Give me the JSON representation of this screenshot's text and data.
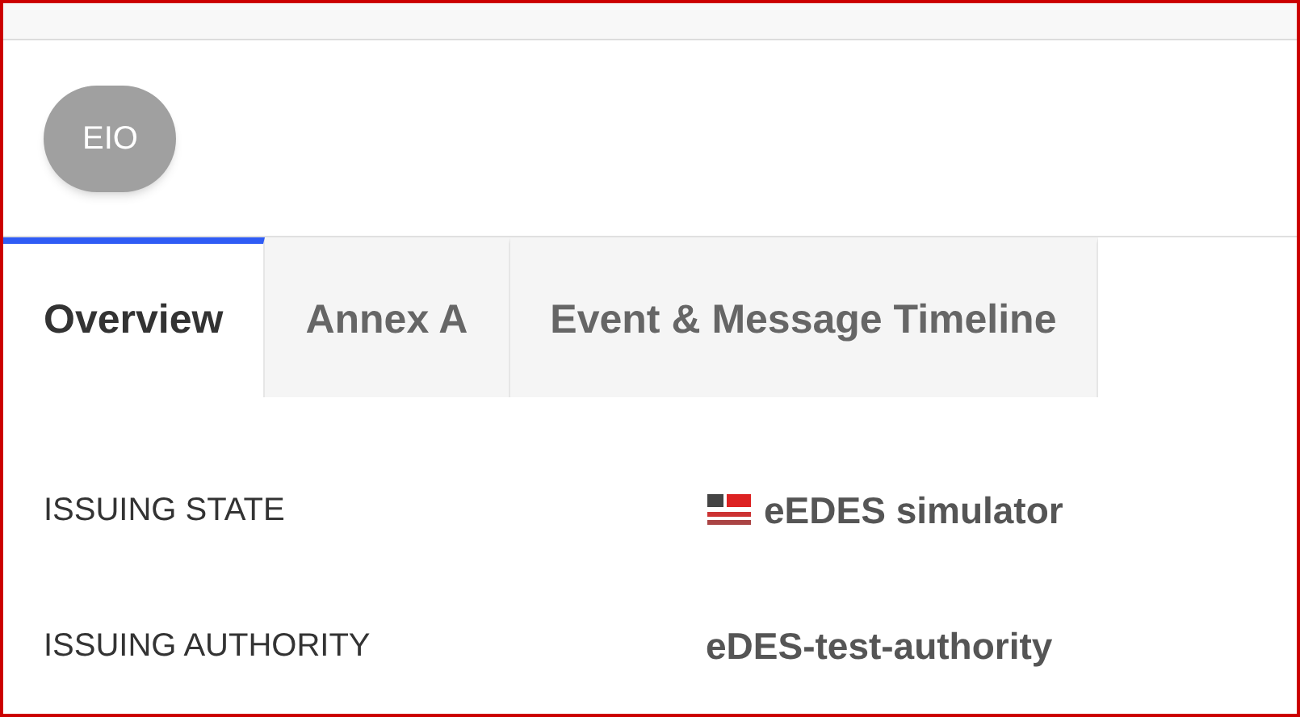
{
  "chip": {
    "label": "EIO"
  },
  "tabs": [
    {
      "label": "Overview",
      "selected": true
    },
    {
      "label": "Annex A",
      "selected": false
    },
    {
      "label": "Event & Message Timeline",
      "selected": false
    }
  ],
  "fields": [
    {
      "label": "ISSUING STATE",
      "value": "eEDES simulator",
      "kind": "flagged"
    },
    {
      "label": "ISSUING AUTHORITY",
      "value": "eDES-test-authority",
      "kind": "plain"
    }
  ]
}
